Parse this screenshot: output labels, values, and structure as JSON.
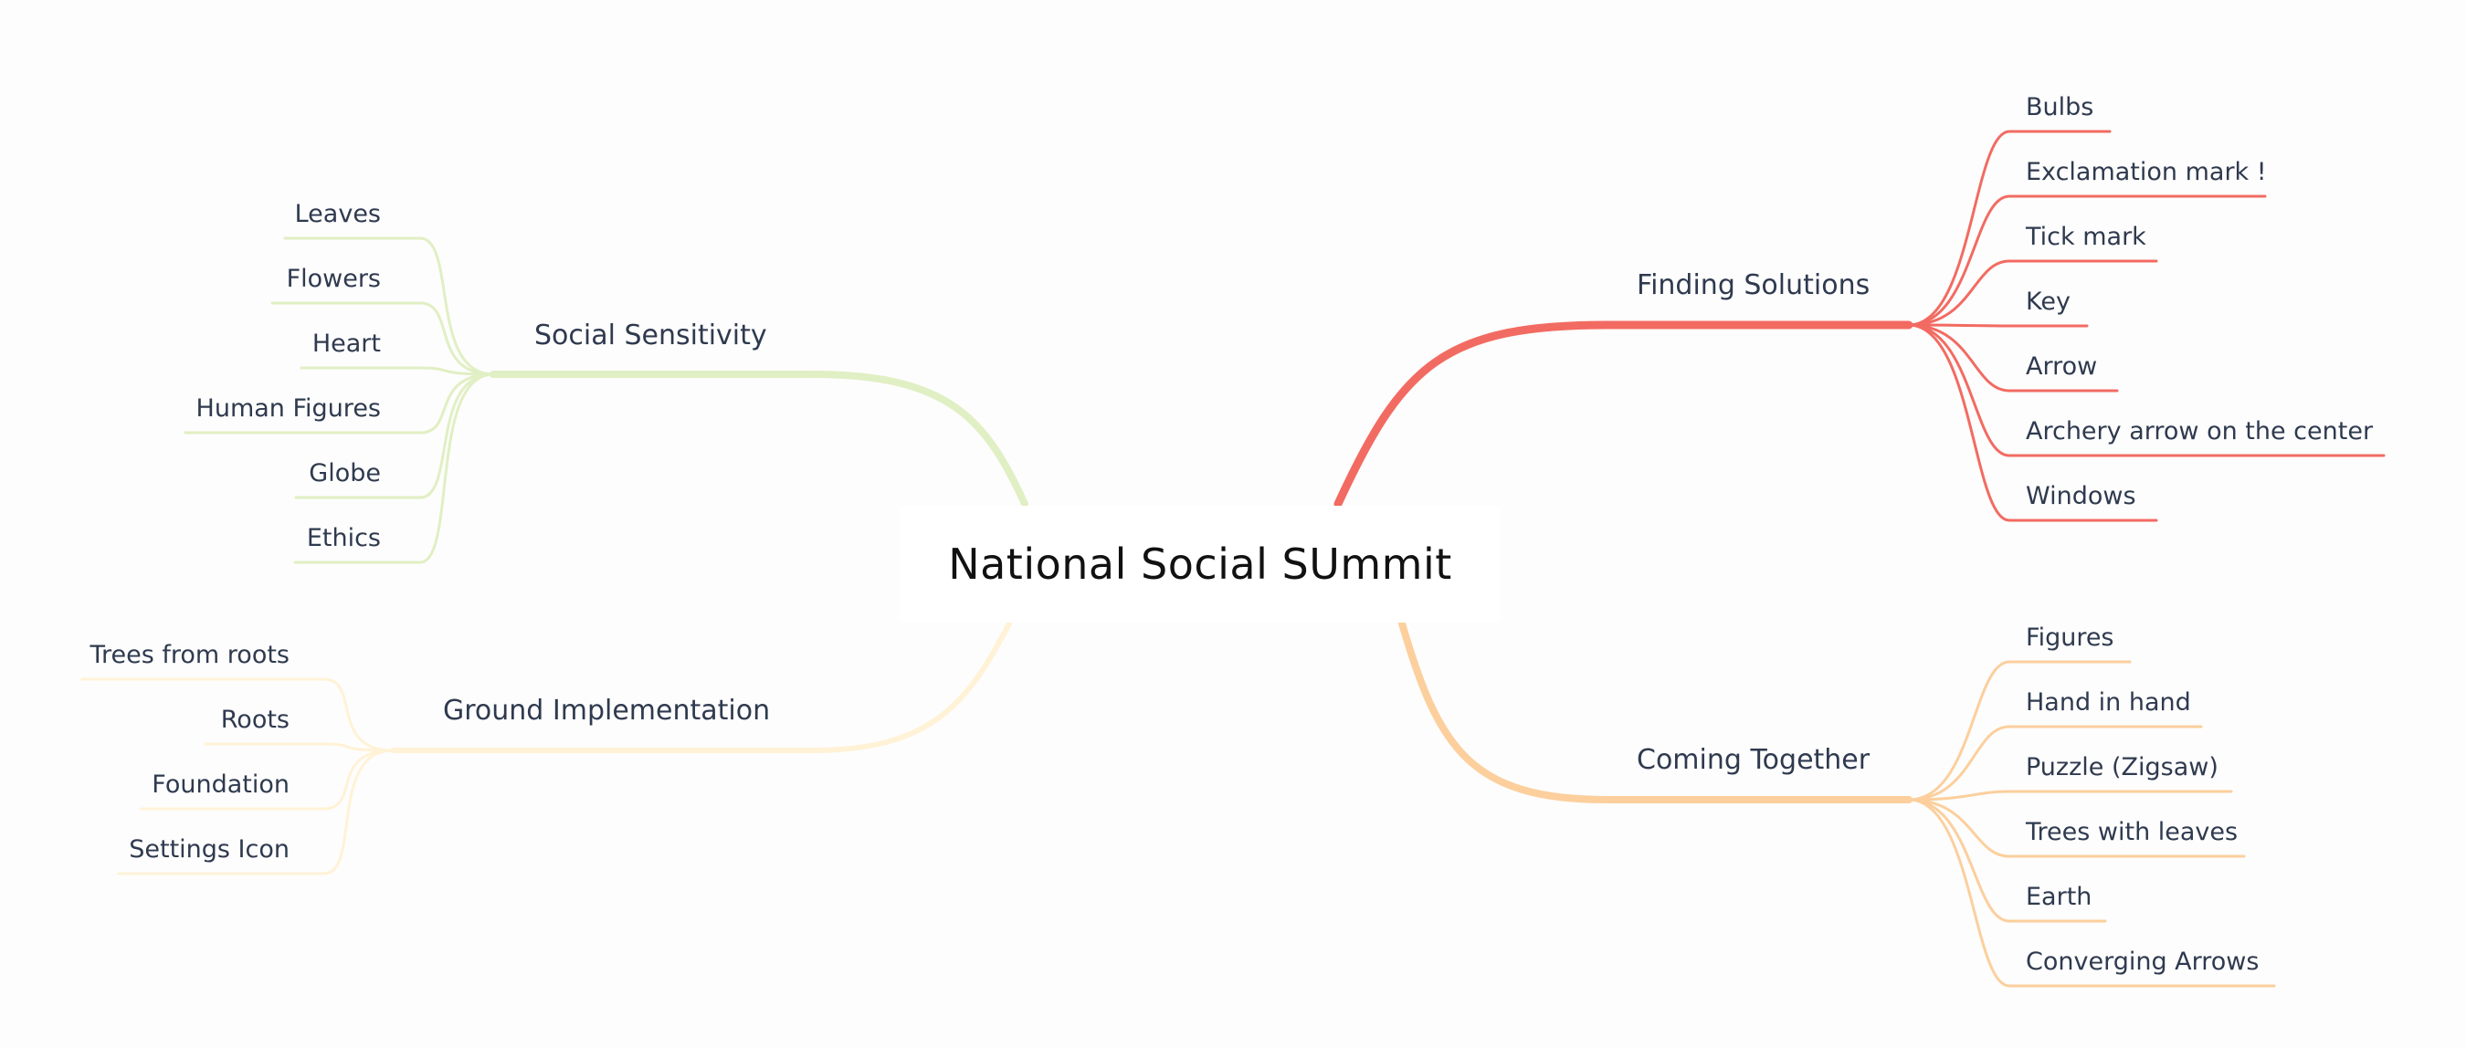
{
  "central_topic": "National Social SUmmit",
  "colors": {
    "finding_solutions": "#f26b62",
    "coming_together": "#fccf9d",
    "social_sensitivity": "#e1efc4",
    "ground_implementation": "#fff2d6"
  },
  "branches": [
    {
      "id": "finding-solutions",
      "title": "Finding Solutions",
      "side": "right",
      "items": [
        "Bulbs",
        "Exclamation mark !",
        "Tick mark",
        "Key",
        "Arrow",
        "Archery arrow on the center",
        "Windows"
      ]
    },
    {
      "id": "coming-together",
      "title": "Coming Together",
      "side": "right",
      "items": [
        "Figures",
        "Hand in hand",
        "Puzzle (Zigsaw)",
        "Trees with leaves",
        "Earth",
        "Converging Arrows"
      ]
    },
    {
      "id": "social-sensitivity",
      "title": "Social Sensitivity",
      "side": "left",
      "items": [
        "Leaves",
        "Flowers",
        "Heart",
        "Human Figures",
        "Globe",
        "Ethics"
      ]
    },
    {
      "id": "ground-implementation",
      "title": "Ground Implementation",
      "side": "left",
      "items": [
        "Trees from roots",
        "Roots",
        "Foundation",
        "Settings Icon"
      ]
    }
  ]
}
